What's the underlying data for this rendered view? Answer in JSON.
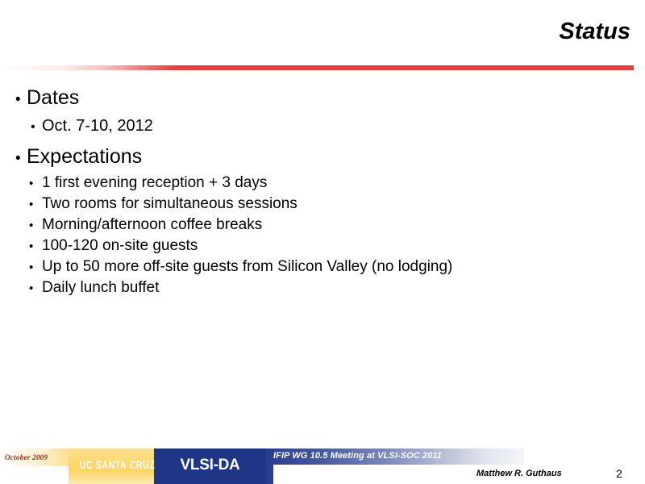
{
  "slide": {
    "title": "Status",
    "page_number": "2",
    "accent_color": "#EE3A3A",
    "navy_color": "#1F3586",
    "gold_color": "#FBD55F"
  },
  "content": {
    "groups": [
      {
        "heading": "Dates",
        "items": [
          {
            "level": 2,
            "text": "Oct. 7-10, 2012"
          }
        ]
      },
      {
        "heading": "Expectations",
        "items": [
          {
            "level": 3,
            "text": "1 first evening reception + 3 days"
          },
          {
            "level": 3,
            "text": "Two rooms for simultaneous sessions"
          },
          {
            "level": 3,
            "text": "Morning/afternoon coffee breaks"
          },
          {
            "level": 3,
            "text": "100-120 on-site guests"
          },
          {
            "level": 3,
            "text": "Up to 50 more off-site guests from Silicon Valley (no lodging)"
          },
          {
            "level": 3,
            "text": "Daily lunch buffet"
          }
        ]
      }
    ],
    "bullet_glyph": "•"
  },
  "footer": {
    "date": "October 2009",
    "ucsc_logo": "UC SANTA CRUZ",
    "group_logo": "VLSI-DA",
    "meeting": "IFIP WG 10.5 Meeting at VLSI-SOC 2011",
    "author": "Matthew R. Guthaus"
  }
}
